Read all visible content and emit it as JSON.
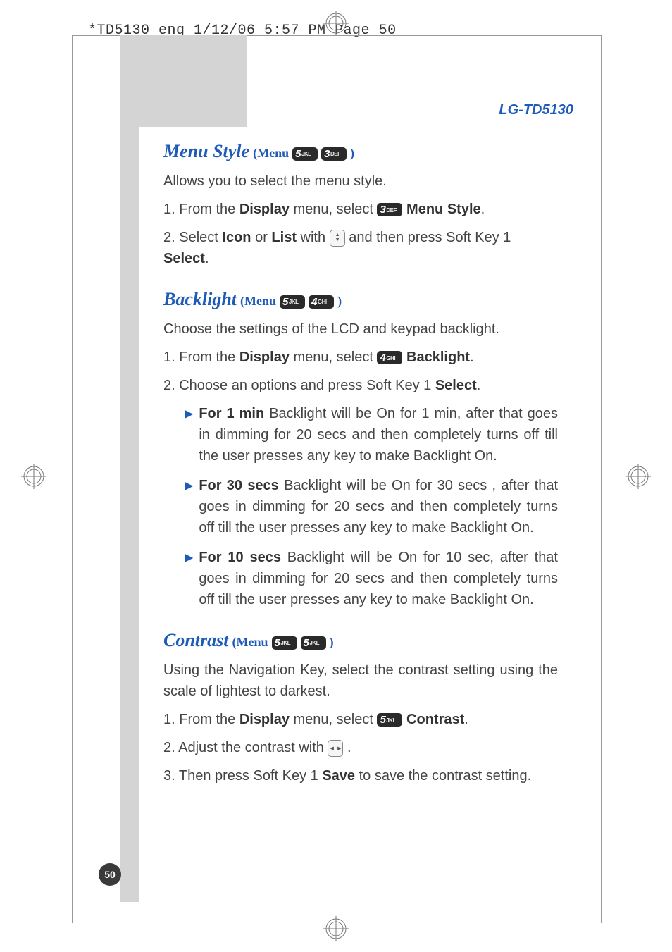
{
  "header_line": "*TD5130_eng  1/12/06  5:57 PM  Page 50",
  "model": "LG-TD5130",
  "page_number": "50",
  "keys": {
    "5": {
      "num": "5",
      "sub": "JKL"
    },
    "3": {
      "num": "3",
      "sub": "DEF"
    },
    "4": {
      "num": "4",
      "sub": "GHI"
    }
  },
  "sections": {
    "menu_style": {
      "title": "Menu Style",
      "menu_word": "(Menu",
      "close_paren": ")",
      "intro": "Allows you to select the menu style.",
      "step1_a": "1. From the ",
      "step1_b": "Display",
      "step1_c": " menu, select ",
      "step1_d": "Menu Style",
      "step1_e": ".",
      "step2_a": "2. Select ",
      "step2_b": "Icon",
      "step2_c": " or ",
      "step2_d": "List",
      "step2_e": " with ",
      "step2_f": " and then press Soft Key 1 ",
      "step2_g": "Select",
      "step2_h": "."
    },
    "backlight": {
      "title": "Backlight",
      "menu_word": "(Menu",
      "close_paren": ")",
      "intro": "Choose the settings of the LCD and keypad backlight.",
      "step1_a": "1. From the ",
      "step1_b": "Display",
      "step1_c": " menu, select ",
      "step1_d": "Backlight",
      "step1_e": ".",
      "step2_a": "2. Choose an options and press Soft Key 1 ",
      "step2_b": "Select",
      "step2_c": ".",
      "bullets": [
        {
          "head": "For 1 min",
          "tail": " Backlight will be On for 1 min, after that goes in dimming for 20 secs and then completely turns off till the user presses any key to make Backlight On."
        },
        {
          "head": "For 30 secs",
          "tail": " Backlight will be On for 30 secs , after that goes in dimming for 20 secs and then completely turns off till the user presses any key to make Backlight On."
        },
        {
          "head": "For 10 secs",
          "tail": " Backlight will be On for 10 sec, after that goes in dimming for 20 secs and then completely turns off till the user presses any key to make Backlight On."
        }
      ]
    },
    "contrast": {
      "title": "Contrast",
      "menu_word": "(Menu",
      "close_paren": ")",
      "intro": "Using the Navigation Key, select the contrast setting using the scale of lightest to darkest.",
      "step1_a": "1. From the ",
      "step1_b": "Display",
      "step1_c": " menu, select ",
      "step1_d": "Contrast",
      "step1_e": ".",
      "step2_a": "2. Adjust the contrast with ",
      "step2_b": " .",
      "step3_a": "3. Then press Soft Key 1 ",
      "step3_b": "Save",
      "step3_c": " to save the contrast setting."
    }
  }
}
